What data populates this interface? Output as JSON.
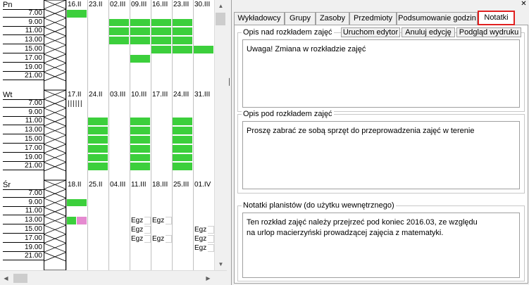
{
  "schedule": {
    "times": [
      "7.00",
      "9.00",
      "11.00",
      "13.00",
      "15.00",
      "17.00",
      "19.00",
      "21.00"
    ],
    "days": [
      {
        "label": "Pn",
        "dates": [
          "16.II",
          "23.II",
          "02.III",
          "09.III",
          "16.III",
          "23.III",
          "30.III"
        ]
      },
      {
        "label": "Wt",
        "dates": [
          "17.II",
          "24.II",
          "03.III",
          "10.III",
          "17.III",
          "24.III",
          "31.III"
        ]
      },
      {
        "label": "Śr",
        "dates": [
          "18.II",
          "25.II",
          "04.III",
          "11.III",
          "18.III",
          "25.III",
          "01.IV"
        ]
      }
    ],
    "exam_label": "Egz",
    "colors": {
      "green": "#3ccf3c",
      "pink": "#e58ad0",
      "active_tab_border": "#e02020"
    }
  },
  "tabs": [
    {
      "label": "Wykładowcy"
    },
    {
      "label": "Grupy"
    },
    {
      "label": "Zasoby"
    },
    {
      "label": "Przedmioty"
    },
    {
      "label": "Podsumowanie godzin"
    },
    {
      "label": "Notatki"
    }
  ],
  "notes": {
    "above": {
      "title": "Opis nad rozkładem zajęć",
      "buttons": [
        "Uruchom edytor",
        "Anuluj edycję",
        "Podgląd wydruku"
      ],
      "text": "Uwaga! Zmiana w rozkładzie zajęć"
    },
    "below": {
      "title": "Opis pod rozkładem zajęć",
      "text": "Proszę zabrać ze sobą sprzęt do przeprowadzenia zajęć w terenie"
    },
    "planners": {
      "title": "Notatki planistów (do użytku wewnętrznego)",
      "text": "Ten rozkład zajęć należy przejrzeć pod koniec 2016.03, ze względu\nna urlop macierzyński prowadzącej zajęcia z matematyki."
    }
  },
  "splitter_mark": "│",
  "close_glyph": "✕"
}
